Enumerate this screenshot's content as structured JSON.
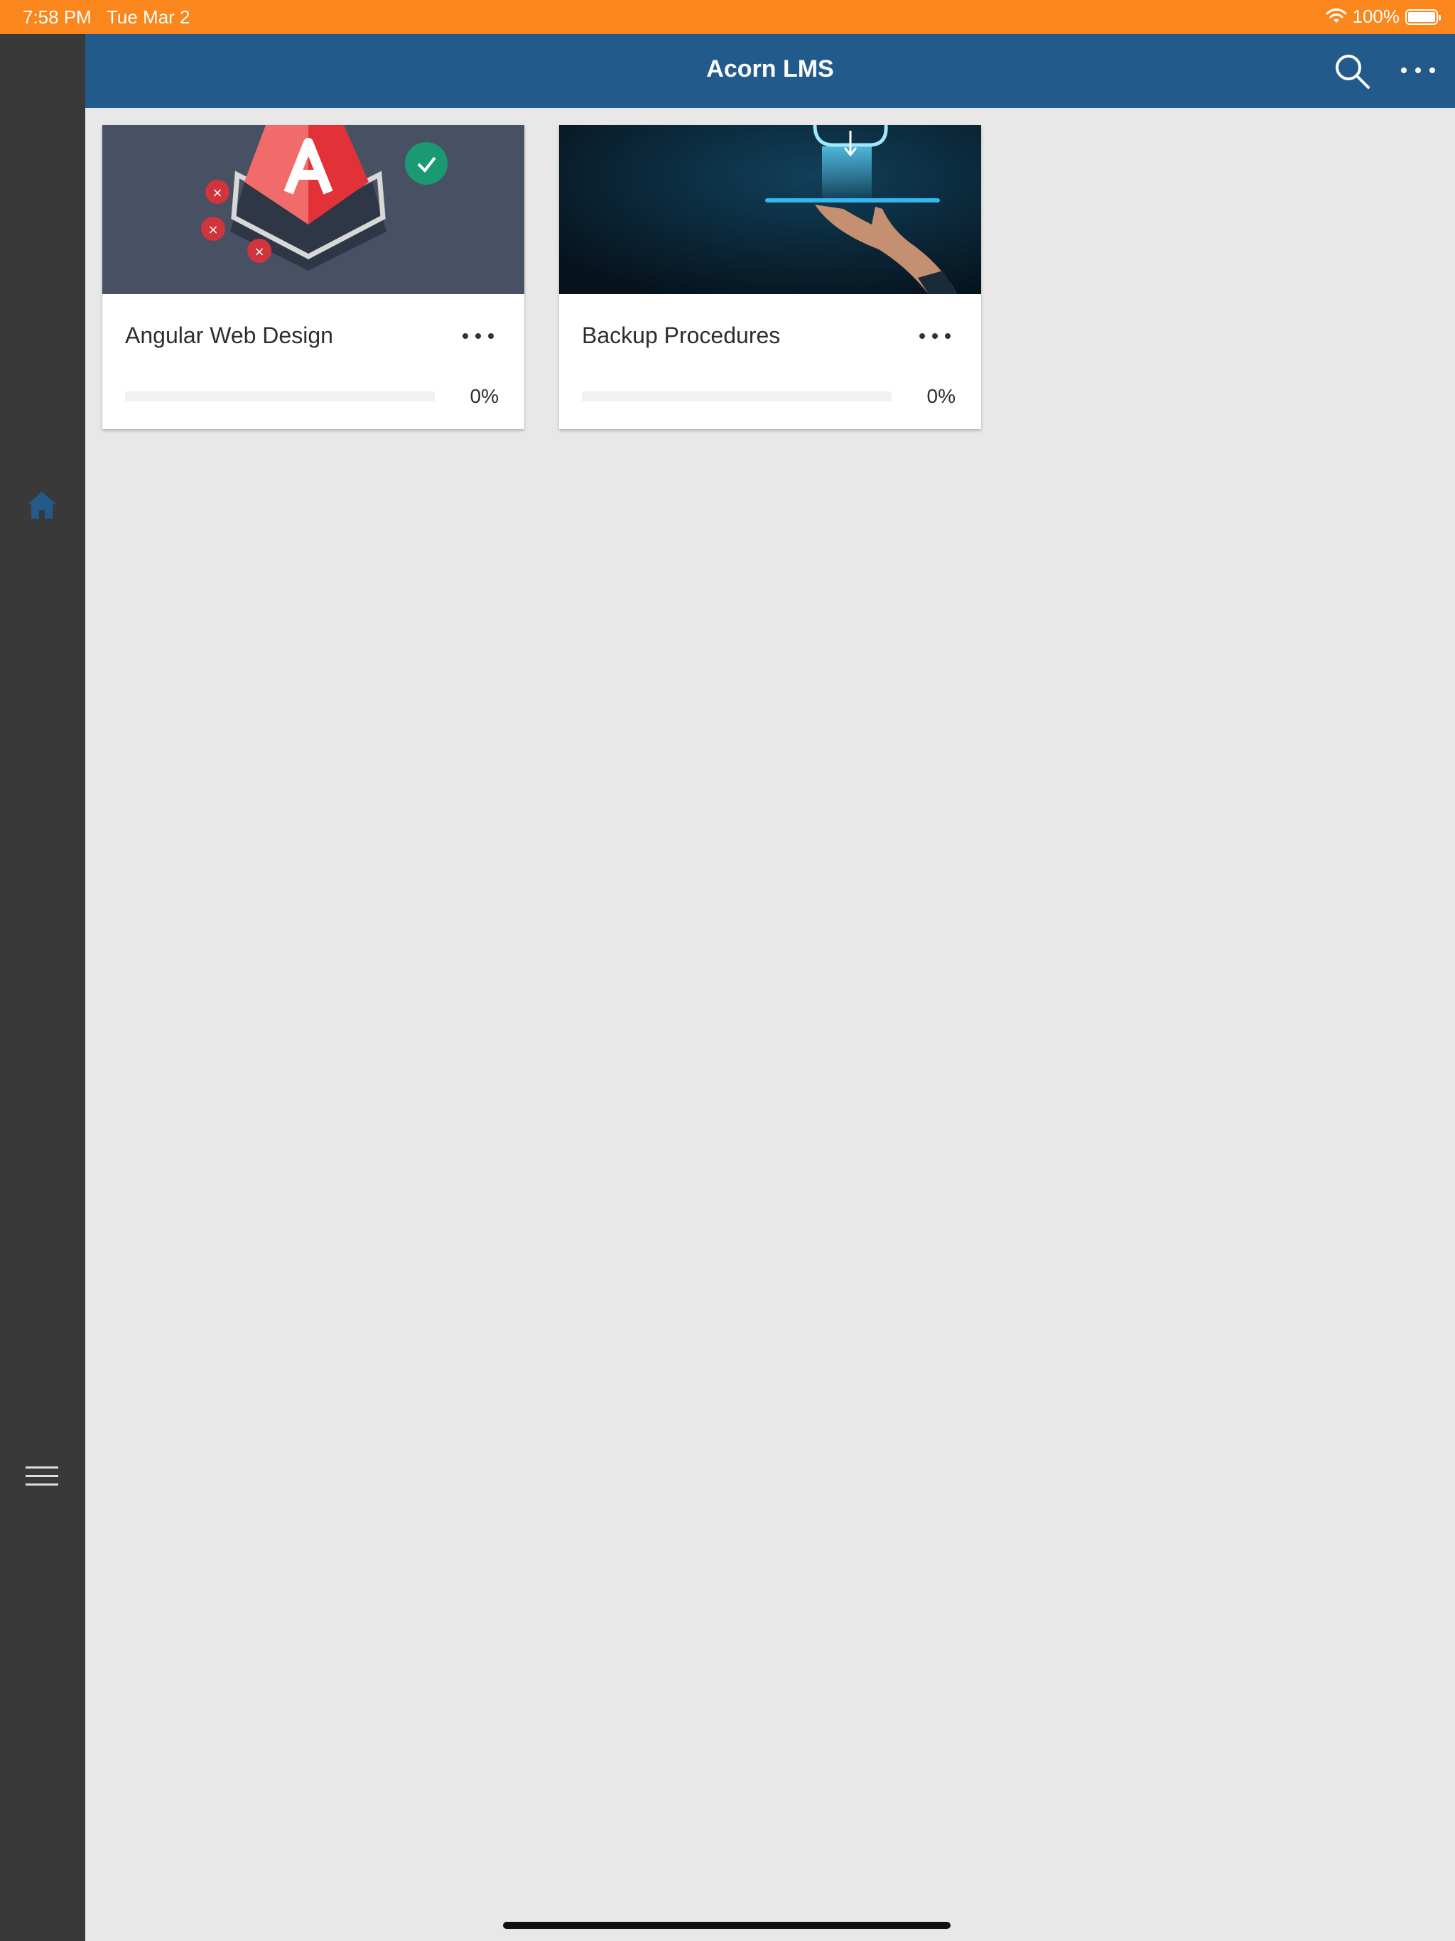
{
  "status_bar": {
    "time": "7:58 PM",
    "date": "Tue Mar 2",
    "battery": "100%"
  },
  "header": {
    "title": "Acorn LMS",
    "search_icon": "search-icon",
    "more_icon": "more-icon"
  },
  "sidebar": {
    "home_icon": "home-icon",
    "menu_icon": "hamburger-menu-icon",
    "accent": "#225a8b"
  },
  "courses": [
    {
      "title": "Angular Web Design",
      "progress_label": "0%",
      "progress": 0
    },
    {
      "title": "Backup Procedures",
      "progress_label": "0%",
      "progress": 0
    }
  ],
  "colors": {
    "status_bar": "#fb861c",
    "header": "#225a8b",
    "sidebar": "#393939",
    "background": "#e8e8e8"
  }
}
